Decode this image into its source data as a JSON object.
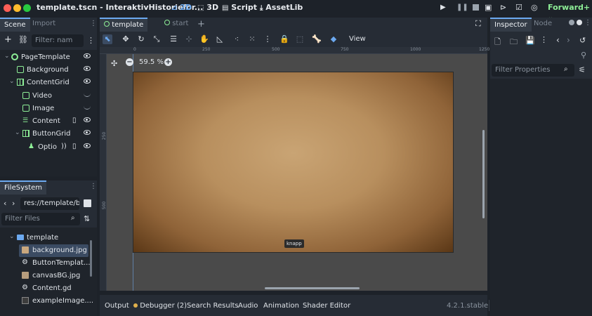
{
  "window": {
    "title": "template.tscn - InteraktivHistoriefor...",
    "workspaces": [
      {
        "label": "2D",
        "active": true
      },
      {
        "label": "3D",
        "active": false
      },
      {
        "label": "Script",
        "active": false
      },
      {
        "label": "AssetLib",
        "active": false
      }
    ],
    "renderer": "Forward+"
  },
  "scene_dock": {
    "tabs": [
      "Scene",
      "Import"
    ],
    "filter_placeholder": "Filter: nam",
    "nodes": [
      {
        "name": "PageTemplate",
        "icon": "node-icon",
        "visible": true
      },
      {
        "name": "Background",
        "icon": "texture-rect-icon",
        "visible": true
      },
      {
        "name": "ContentGrid",
        "icon": "grid-container-icon",
        "visible": true
      },
      {
        "name": "Video",
        "icon": "video-player-icon",
        "visible": false
      },
      {
        "name": "Image",
        "icon": "texture-rect-icon",
        "visible": false
      },
      {
        "name": "Content",
        "icon": "rich-text-label-icon",
        "visible": true
      },
      {
        "name": "ButtonGrid",
        "icon": "grid-container-icon",
        "visible": true
      },
      {
        "name": "Optio",
        "icon": "instance-icon",
        "visible": true
      }
    ]
  },
  "filesystem_dock": {
    "tab": "FileSystem",
    "path": "res://template/ba",
    "filter_placeholder": "Filter Files",
    "items": [
      {
        "name": "template",
        "type": "folder"
      },
      {
        "name": "background.jpg",
        "type": "image",
        "selected": true
      },
      {
        "name": "ButtonTemplat...",
        "type": "scene"
      },
      {
        "name": "canvasBG.jpg",
        "type": "image"
      },
      {
        "name": "Content.gd",
        "type": "script"
      },
      {
        "name": "exampleImage....",
        "type": "image"
      }
    ]
  },
  "editor": {
    "tabs": [
      {
        "label": "template",
        "active": true
      },
      {
        "label": "start",
        "active": false
      }
    ],
    "zoom": "59.5 %",
    "view_menu": "View",
    "ruler_ticks": [
      "0",
      "250",
      "500",
      "750",
      "1000",
      "1250"
    ],
    "vruler_ticks": [
      "250",
      "500"
    ],
    "node_label": "knapp"
  },
  "inspector": {
    "tabs": [
      "Inspector",
      "Node"
    ],
    "filter_placeholder": "Filter Properties"
  },
  "bottom_panel": {
    "tabs": [
      "Output",
      "Debugger (2)",
      "Search Results",
      "Audio",
      "Animation",
      "Shader Editor"
    ],
    "version": "4.2.1.stable",
    "debugger_color": "#e0b04c"
  },
  "colors": {
    "accent": "#6ca9f0",
    "node_green": "#8eef97",
    "folder_blue": "#6ca9f0"
  }
}
